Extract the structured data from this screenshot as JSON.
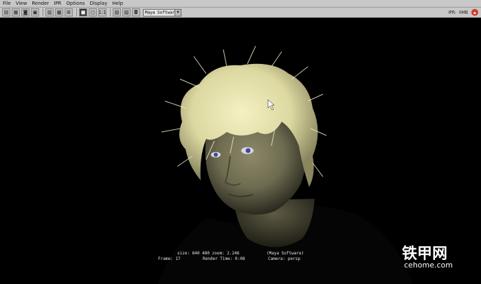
{
  "menu": [
    "File",
    "View",
    "Render",
    "IPR",
    "Options",
    "Display",
    "Help"
  ],
  "toolbar": {
    "ratio_label": "1:1",
    "renderer": "Maya Software",
    "ipr_label": "IPR:",
    "ipr_value": "0MB"
  },
  "status": {
    "size_label": "size:",
    "size_value": "640  480",
    "zoom_label": "zoom:",
    "zoom_value": "2.246",
    "frame_label": "Frame:",
    "frame_value": "17",
    "render_time_label": "Render Time:",
    "render_time_value": "0:08",
    "renderer_label": "(Maya Software)",
    "camera_label": "Camera:",
    "camera_value": "persp"
  },
  "watermark": {
    "brand": "铁甲网",
    "url": "cehome.com"
  }
}
